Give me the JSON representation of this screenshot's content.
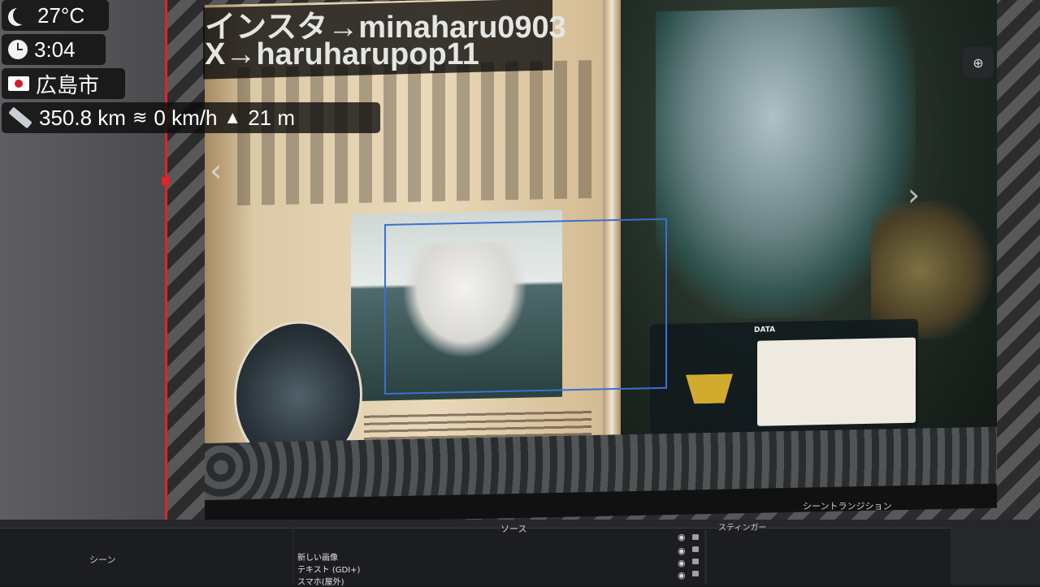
{
  "status_overlay": {
    "temperature": "27°C",
    "time": "3:04",
    "city": "広島市",
    "distance": "350.8 km",
    "speed": "0 km/h",
    "altitude": "21 m",
    "icons": [
      "moon-icon",
      "clock-icon",
      "japan-flag-icon",
      "ruler-icon",
      "wind-icon",
      "mountain-icon"
    ]
  },
  "stream_text": {
    "line1": "インスタ→minaharu0903",
    "line2": "X→haruharupop11"
  },
  "book_panel": {
    "data_label": "DATA"
  },
  "obs": {
    "scenes_title": "シーン",
    "sources_title": "ソース",
    "transition_title": "シーントランジション",
    "transition_value": "スティンガー",
    "sources": [
      "新しい画像",
      "テキスト (GDI+)",
      "スマホ(屋外)"
    ]
  },
  "colors": {
    "selection_box": "#3b6fd1",
    "guide_line": "#e0242a",
    "overlay_bg": "#0a0a0a"
  }
}
